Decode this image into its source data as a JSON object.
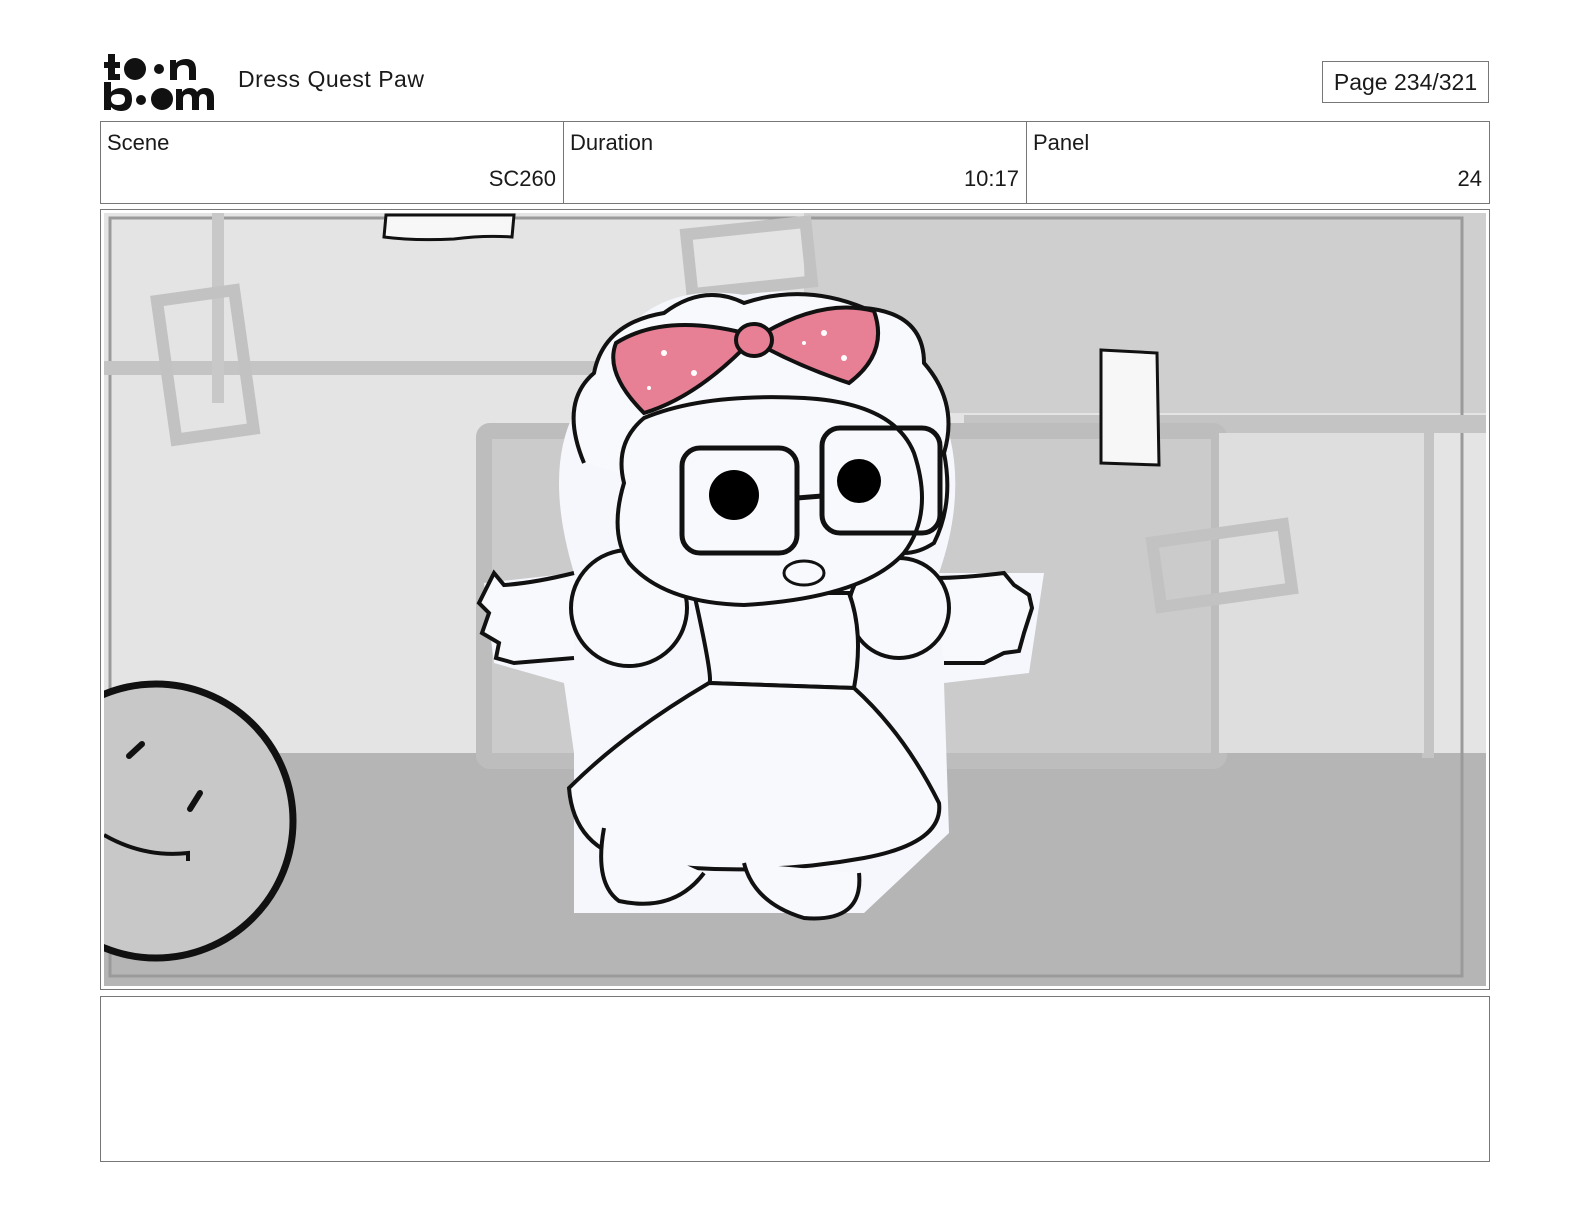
{
  "header": {
    "logo_text": "toon boom",
    "project_title": "Dress Quest Paw",
    "page_label": "Page 234/321"
  },
  "info": {
    "scene_label": "Scene",
    "scene_value": "SC260",
    "duration_label": "Duration",
    "duration_value": "10:17",
    "panel_label": "Panel",
    "panel_value": "24"
  },
  "panel": {
    "description": "",
    "bow_color": "#e77f95"
  },
  "notes": {
    "text": ""
  }
}
